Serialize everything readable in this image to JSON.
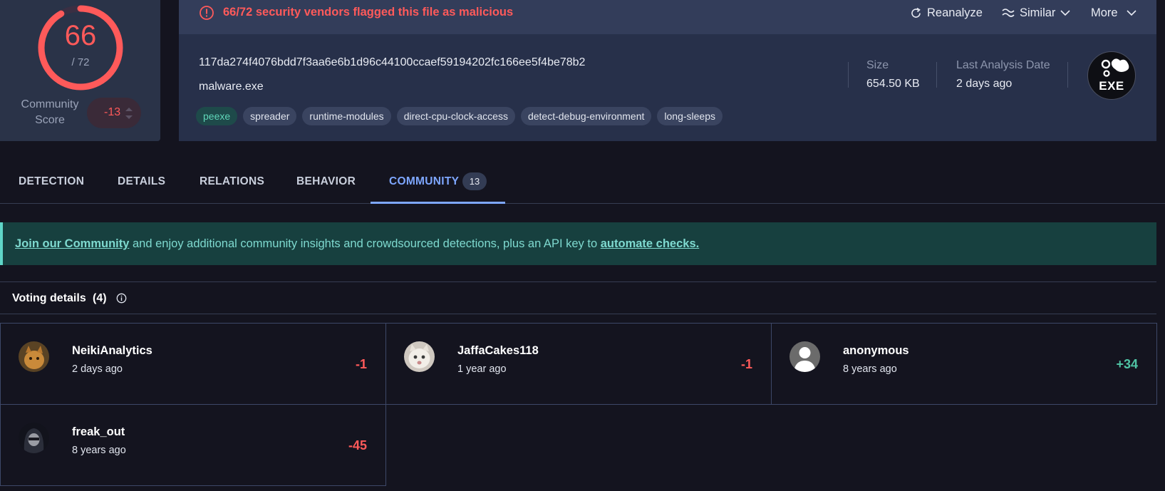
{
  "score": {
    "detections": "66",
    "total": "/ 72",
    "community_label": "Community Score",
    "community_value": "-13",
    "fill_fraction": 0.9167
  },
  "alert": {
    "text": "66/72 security vendors flagged this file as malicious"
  },
  "actions": {
    "reanalyze": "Reanalyze",
    "similar": "Similar",
    "more": "More"
  },
  "file": {
    "hash": "117da274f4076bdd7f3aa6e6b1d96c44100ccaef59194202fc166ee5f4be78b2",
    "name": "malware.exe",
    "tags": [
      "peexe",
      "spreader",
      "runtime-modules",
      "direct-cpu-clock-access",
      "detect-debug-environment",
      "long-sleeps"
    ],
    "size_label": "Size",
    "size_value": "654.50 KB",
    "date_label": "Last Analysis Date",
    "date_value": "2 days ago",
    "type_badge": "EXE"
  },
  "tabs": {
    "detection": "DETECTION",
    "details": "DETAILS",
    "relations": "RELATIONS",
    "behavior": "BEHAVIOR",
    "community": "COMMUNITY",
    "community_count": "13",
    "active": "community"
  },
  "banner": {
    "link1": "Join our Community",
    "middle": " and enjoy additional community insights and crowdsourced detections, plus an API key to ",
    "link2": "automate checks."
  },
  "voting": {
    "title": "Voting details",
    "count": "(4)",
    "votes": [
      {
        "name": "NeikiAnalytics",
        "time": "2 days ago",
        "value": "-1",
        "sign": "neg",
        "avatar": "cat-photo-avatar"
      },
      {
        "name": "JaffaCakes118",
        "time": "1 year ago",
        "value": "-1",
        "sign": "neg",
        "avatar": "white-cat-avatar"
      },
      {
        "name": "anonymous",
        "time": "8 years ago",
        "value": "+34",
        "sign": "pos",
        "avatar": "default-user-avatar"
      },
      {
        "name": "freak_out",
        "time": "8 years ago",
        "value": "-45",
        "sign": "neg",
        "avatar": "hooded-figure-avatar"
      }
    ]
  },
  "colors": {
    "danger": "#ff5a5a",
    "accent": "#7ea7ff",
    "positive": "#4fc3a4",
    "banner": "#17403f"
  }
}
